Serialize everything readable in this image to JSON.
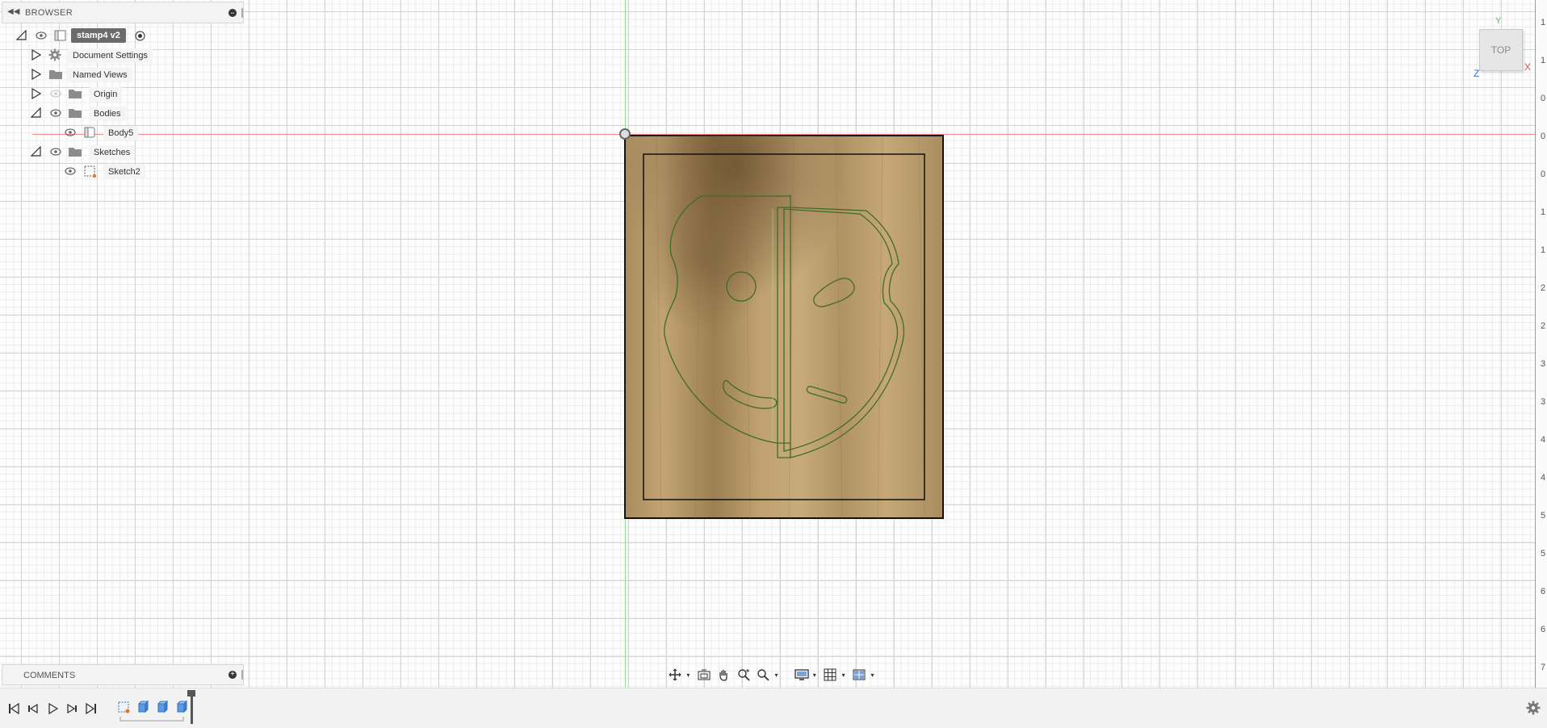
{
  "browser": {
    "title": "BROWSER",
    "root": {
      "label": "stamp4 v2"
    },
    "items": [
      {
        "label": "Document Settings",
        "icon": "gear-icon"
      },
      {
        "label": "Named Views",
        "icon": "folder-icon"
      },
      {
        "label": "Origin",
        "icon": "folder-icon"
      },
      {
        "label": "Bodies",
        "icon": "folder-icon"
      },
      {
        "label": "Body5",
        "icon": "body-icon"
      },
      {
        "label": "Sketches",
        "icon": "folder-icon"
      },
      {
        "label": "Sketch2",
        "icon": "sketch-icon"
      }
    ]
  },
  "comments": {
    "title": "COMMENTS"
  },
  "viewcube": {
    "face": "TOP",
    "x": "X",
    "y": "Y",
    "z": "Z"
  },
  "ruler": {
    "ticks": [
      "1",
      "1",
      "0",
      "0",
      "0",
      "1",
      "1",
      "2",
      "2",
      "3",
      "3",
      "4",
      "4",
      "5",
      "5",
      "6",
      "6",
      "7"
    ]
  },
  "nav_toolbar": {
    "tools": [
      "orbit-icon",
      "look-at-icon",
      "pan-icon",
      "zoom-icon",
      "fit-icon",
      "display-settings-icon",
      "grid-settings-icon",
      "viewports-icon"
    ]
  },
  "timeline": {
    "controls": [
      "skip-start-icon",
      "step-back-icon",
      "play-icon",
      "step-forward-icon",
      "skip-end-icon"
    ],
    "features": [
      "sketch-feature-icon",
      "extrude-feature-icon",
      "extrude-feature-icon",
      "extrude-feature-icon"
    ]
  },
  "colors": {
    "x_axis": "#f08a8a",
    "y_axis": "#8fe38f",
    "sketch_line": "#3f6b2a",
    "wood": "#b89a6a"
  }
}
